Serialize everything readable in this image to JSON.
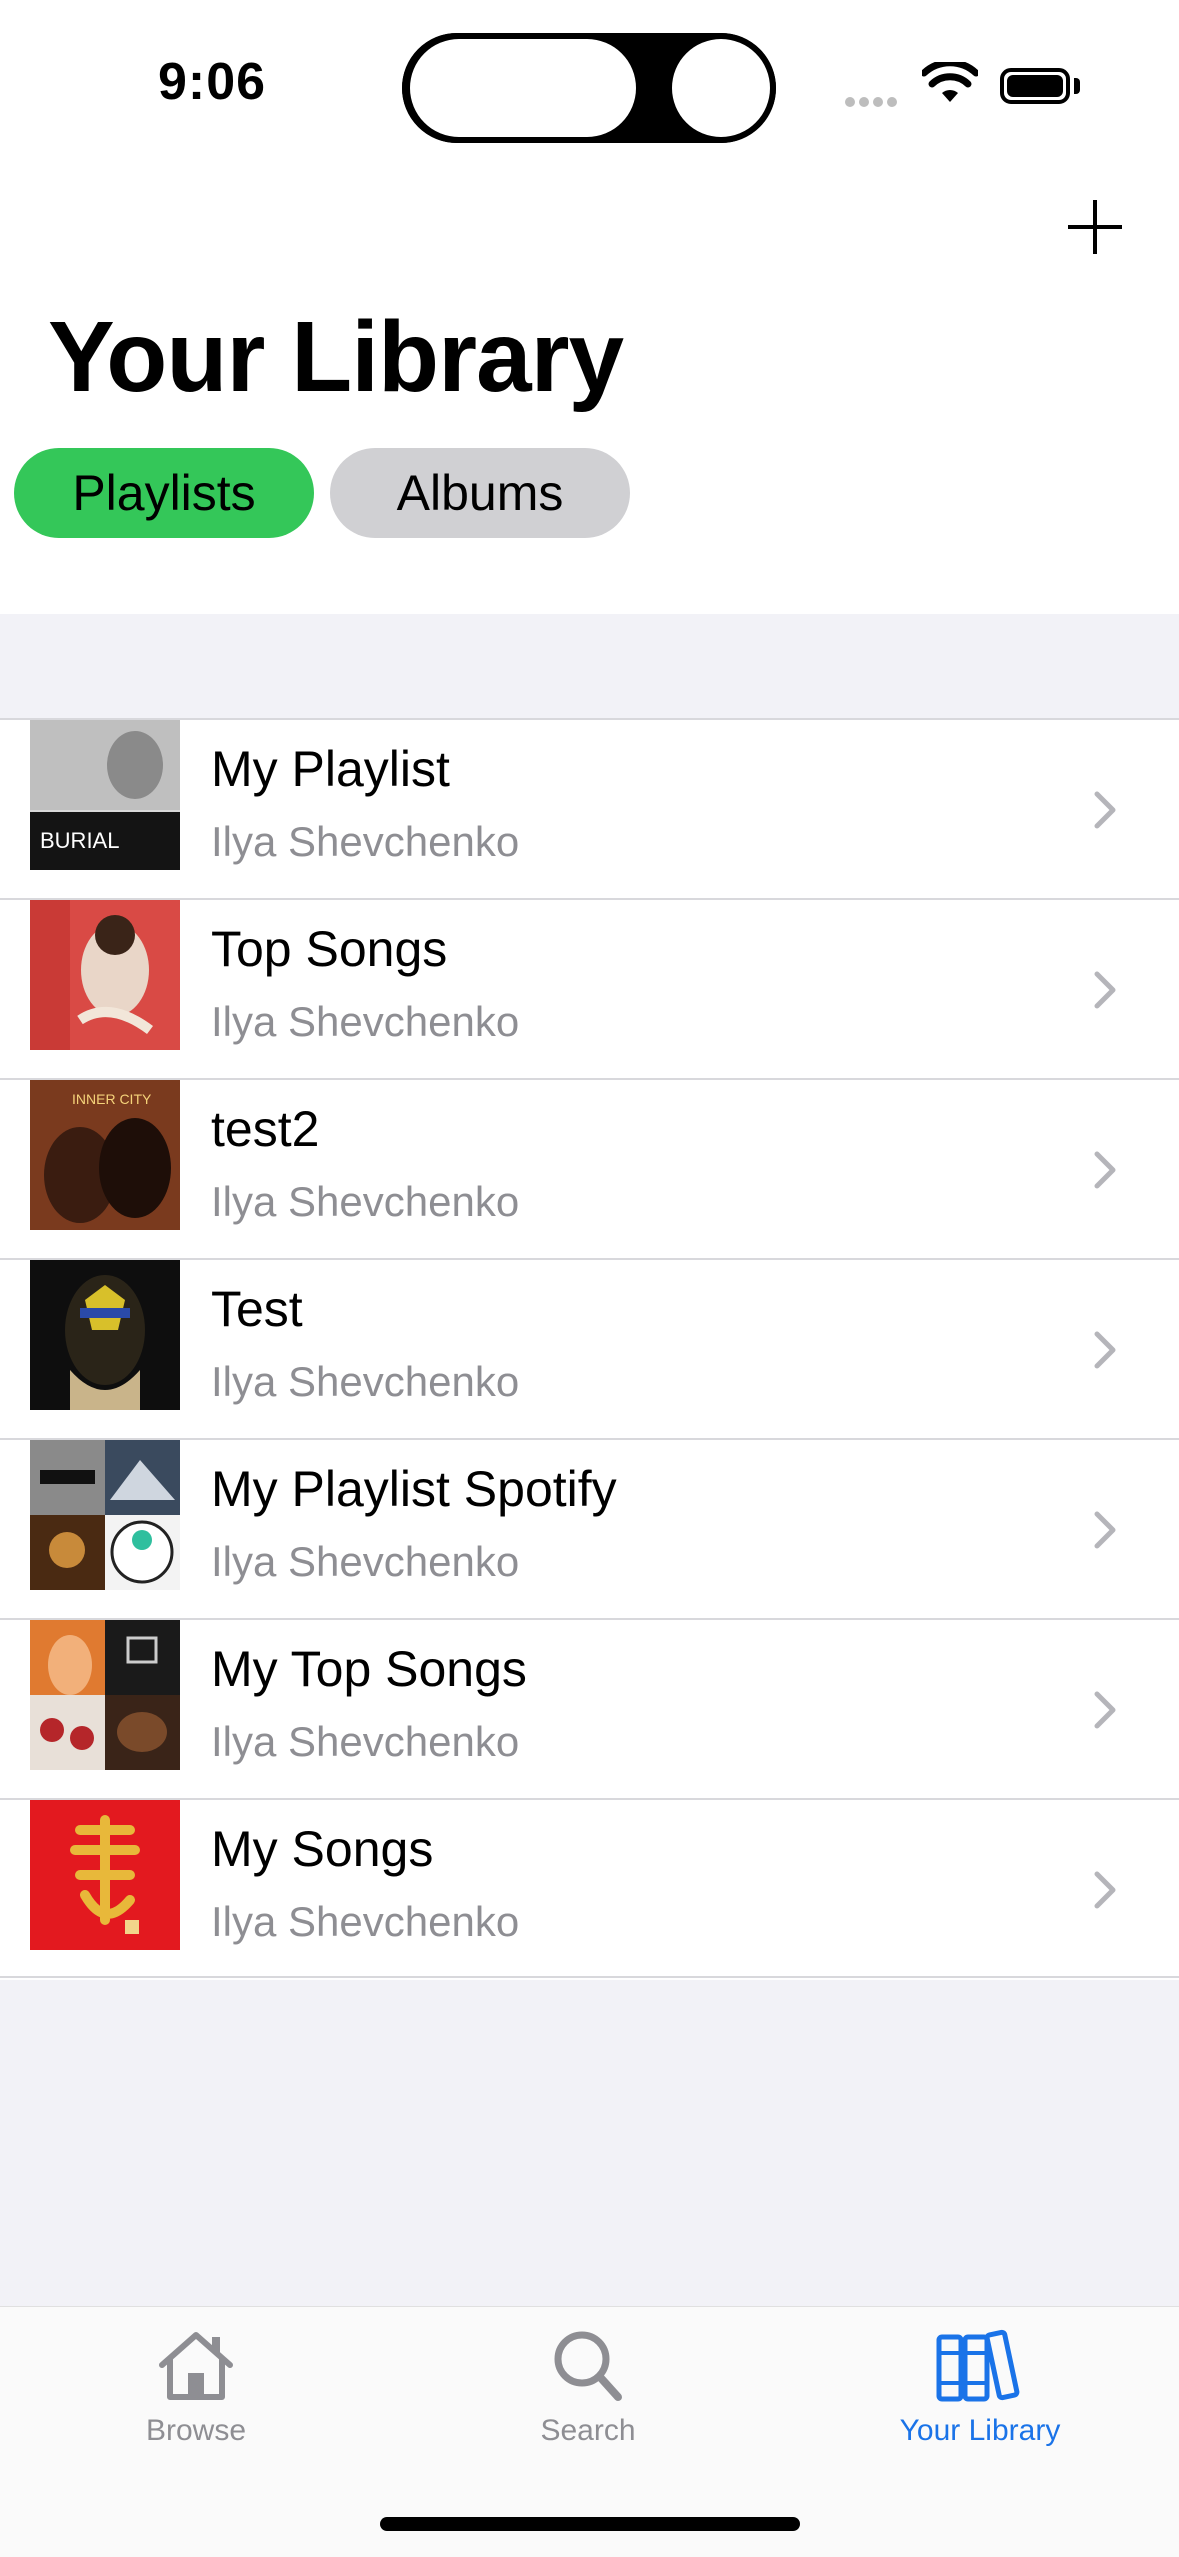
{
  "status_bar": {
    "time": "9:06"
  },
  "header": {
    "add_icon": "plus-icon",
    "title": "Your Library"
  },
  "segments": [
    {
      "label": "Playlists",
      "selected": true,
      "color": "#34c759"
    },
    {
      "label": "Albums",
      "selected": false,
      "color": "#d0d0d3"
    }
  ],
  "playlists": [
    {
      "title": "My Playlist",
      "owner": "Ilya Shevchenko",
      "art_text": "BURIAL"
    },
    {
      "title": "Top Songs",
      "owner": "Ilya Shevchenko",
      "art_text": ""
    },
    {
      "title": "test2",
      "owner": "Ilya Shevchenko",
      "art_text": "INNER CITY"
    },
    {
      "title": "Test",
      "owner": "Ilya Shevchenko",
      "art_text": ""
    },
    {
      "title": "My Playlist Spotify",
      "owner": "Ilya Shevchenko",
      "art_text": ""
    },
    {
      "title": "My Top Songs",
      "owner": "Ilya Shevchenko",
      "art_text": ""
    },
    {
      "title": "My Songs",
      "owner": "Ilya Shevchenko",
      "art_text": ""
    }
  ],
  "tab_bar": {
    "tabs": [
      {
        "label": "Browse",
        "icon": "house-icon",
        "active": false
      },
      {
        "label": "Search",
        "icon": "magnifier-icon",
        "active": false
      },
      {
        "label": "Your Library",
        "icon": "library-icon",
        "active": true
      }
    ],
    "active_color": "#1a73e8",
    "inactive_color": "#8e8e93"
  }
}
